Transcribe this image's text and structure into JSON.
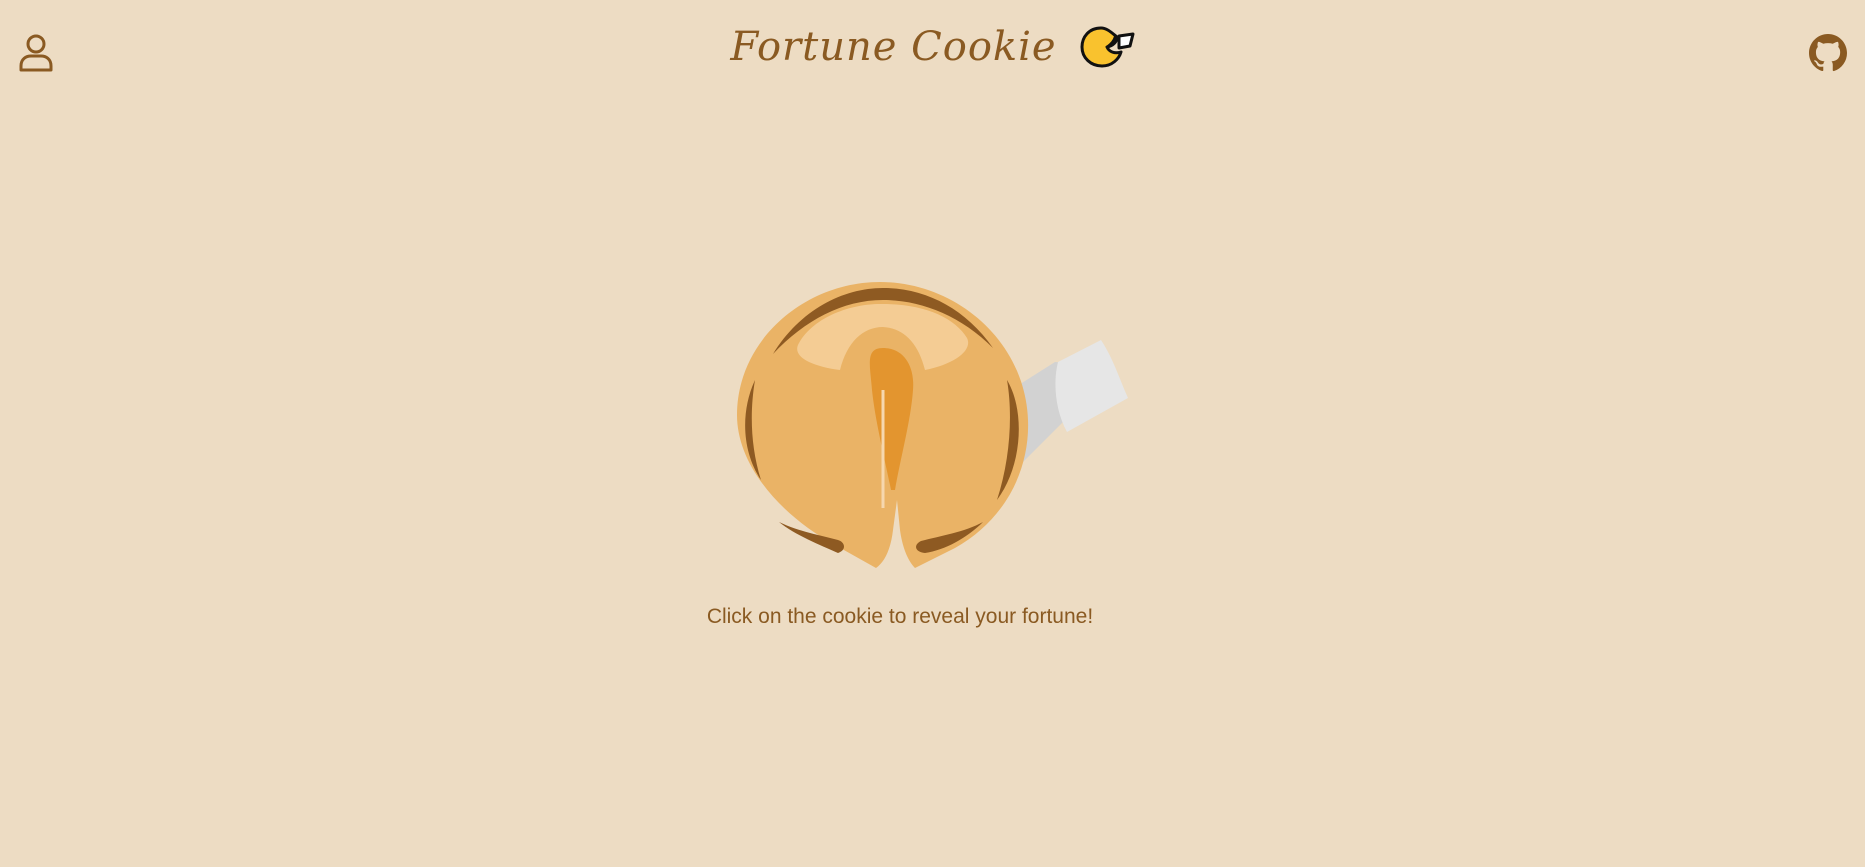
{
  "header": {
    "title": "Fortune Cookie",
    "user_icon": "user-icon",
    "logo_icon": "fortune-cookie-logo-icon",
    "github_icon": "github-icon"
  },
  "main": {
    "cookie_icon": "fortune-cookie-icon",
    "hint": "Click on the cookie to reveal your fortune!"
  },
  "colors": {
    "background": "#EDDCC3",
    "brand_brown": "#8A5A22",
    "cookie_body": "#EAB366",
    "cookie_highlight": "#F4CC94",
    "cookie_center": "#E3952F",
    "paper": "#E3E3E3",
    "logo_yellow": "#F9C22E"
  }
}
